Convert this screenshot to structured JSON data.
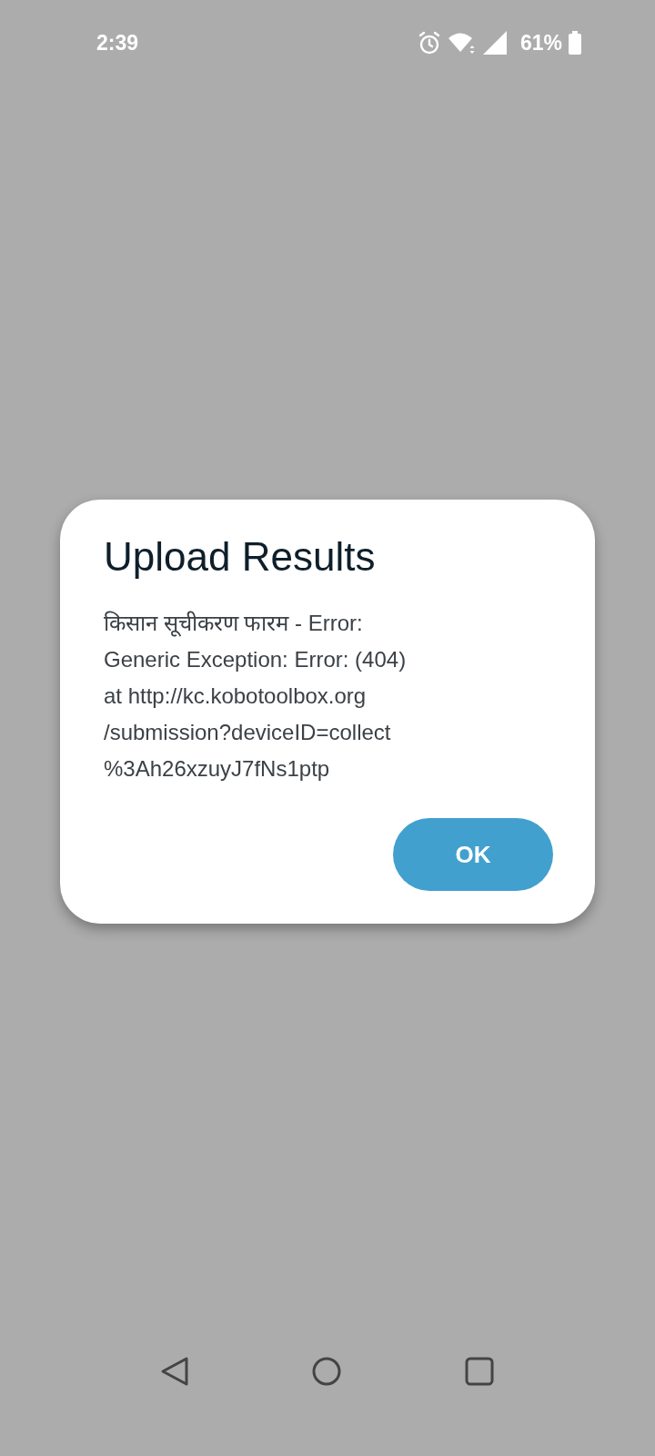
{
  "status_bar": {
    "time": "2:39",
    "battery": "61%"
  },
  "dialog": {
    "title": "Upload Results",
    "message": "किसान सूचीकरण फारम - Error:\nGeneric Exception: Error:  (404)\nat http://kc.kobotoolbox.org\n/submission?deviceID=collect\n%3Ah26xzuyJ7fNs1ptp",
    "buttons": [
      "OK"
    ]
  }
}
